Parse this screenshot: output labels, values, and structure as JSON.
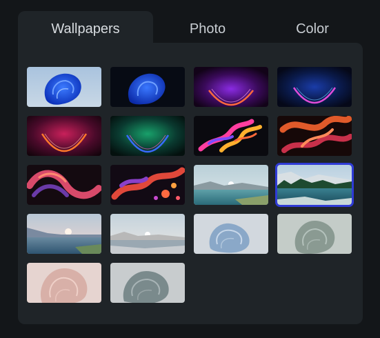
{
  "tabs": [
    {
      "label": "Wallpapers",
      "active": true
    },
    {
      "label": "Photo",
      "active": false
    },
    {
      "label": "Color",
      "active": false
    }
  ],
  "accent": "#2f3bd6",
  "wallpapers": [
    {
      "name": "bloom-blue-light"
    },
    {
      "name": "bloom-blue-dark"
    },
    {
      "name": "glow-purple"
    },
    {
      "name": "glow-blue"
    },
    {
      "name": "glow-red"
    },
    {
      "name": "glow-green"
    },
    {
      "name": "ribbon-colorful-dark"
    },
    {
      "name": "ribbon-orange"
    },
    {
      "name": "ribbon-purple-swirl"
    },
    {
      "name": "ribbon-bubbles"
    },
    {
      "name": "lake-sunrise"
    },
    {
      "name": "lake-forest",
      "selected": true
    },
    {
      "name": "lake-pink-dawn"
    },
    {
      "name": "lake-pale"
    },
    {
      "name": "bloom-ice-blue"
    },
    {
      "name": "bloom-sage"
    },
    {
      "name": "bloom-blush"
    },
    {
      "name": "bloom-grey"
    }
  ]
}
